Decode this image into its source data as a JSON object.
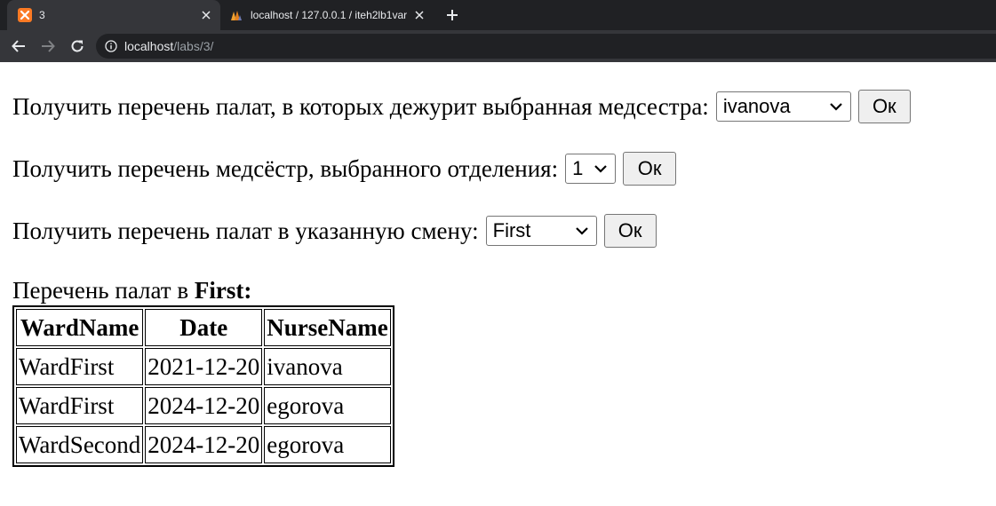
{
  "browser": {
    "tabs": [
      {
        "title": "3",
        "favicon": "xampp-icon",
        "active": true
      },
      {
        "title": "localhost / 127.0.0.1 / iteh2lb1var",
        "favicon": "phpmyadmin-icon",
        "active": false
      }
    ],
    "url_host": "localhost",
    "url_path": "/labs/3/"
  },
  "forms": [
    {
      "label": "Получить перечень палат, в которых дежурит выбранная медсестра:",
      "selected": "ivanova",
      "button": "Ок"
    },
    {
      "label": "Получить перечень медсёстр, выбранного отделения:",
      "selected": "1",
      "button": "Ок"
    },
    {
      "label": "Получить перечень палат в указанную смену:",
      "selected": "First",
      "button": "Ок"
    }
  ],
  "result": {
    "caption_prefix": "Перечень палат в",
    "caption_value": "First:",
    "columns": [
      "WardName",
      "Date",
      "NurseName"
    ],
    "rows": [
      [
        "WardFirst",
        "2021-12-20",
        "ivanova"
      ],
      [
        "WardFirst",
        "2024-12-20",
        "egorova"
      ],
      [
        "WardSecond",
        "2024-12-20",
        "egorova"
      ]
    ]
  },
  "colors": {
    "tabbar_bg": "#202124",
    "toolbar_bg": "#35363a",
    "xampp_orange": "#fb7a24"
  }
}
